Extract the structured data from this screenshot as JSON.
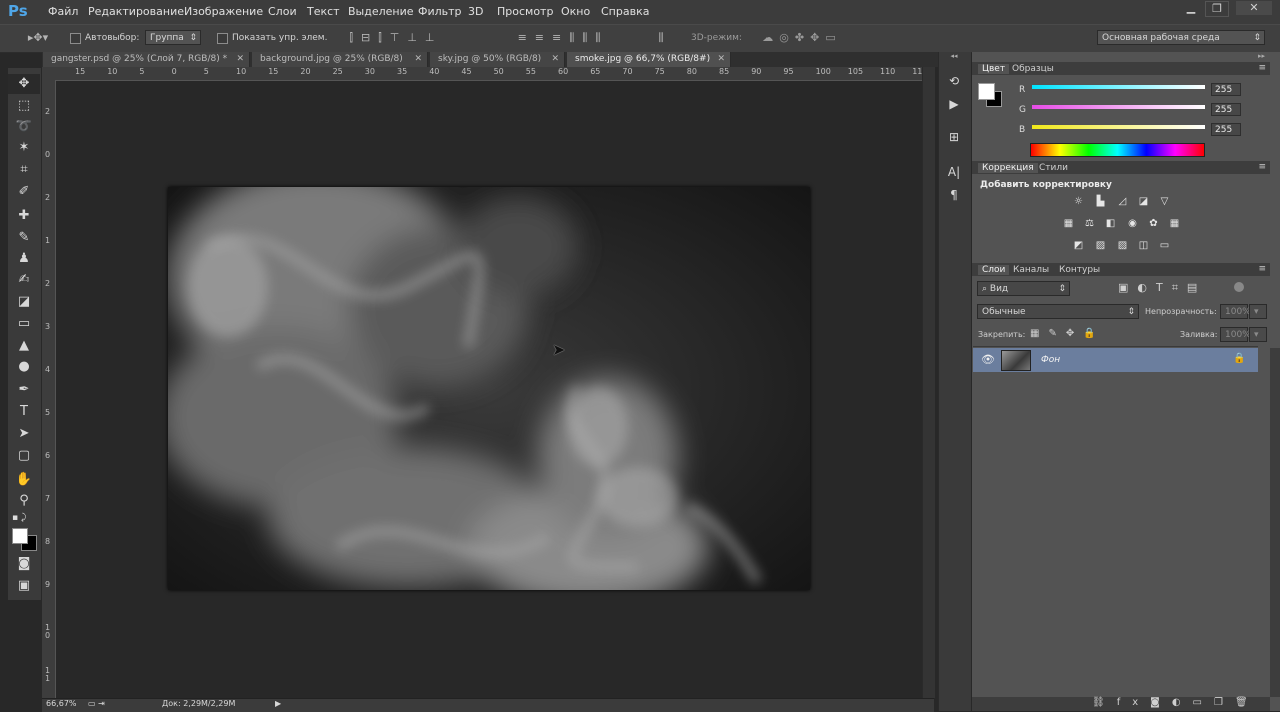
{
  "app": {
    "logo": "Ps"
  },
  "menu": [
    "Файл",
    "Редактирование",
    "Изображение",
    "Слои",
    "Текст",
    "Выделение",
    "Фильтр",
    "3D",
    "Просмотр",
    "Окно",
    "Справка"
  ],
  "window_buttons": {
    "minimize": "▁",
    "maximize": "❐",
    "close": "✕"
  },
  "options": {
    "autoselect_label": "Автовыбор:",
    "autoselect_value": "Группа",
    "show_transform_label": "Показать упр. элем.",
    "mode3d_label": "3D-режим:",
    "workspace": "Основная рабочая среда"
  },
  "tabs": [
    {
      "label": "gangster.psd @ 25% (Слой 7, RGB/8) *",
      "close": "✕"
    },
    {
      "label": "background.jpg @ 25% (RGB/8)",
      "close": "✕"
    },
    {
      "label": "sky.jpg @ 50% (RGB/8)",
      "close": "✕"
    },
    {
      "label": "smoke.jpg @ 66,7% (RGB/8#)",
      "close": "✕"
    }
  ],
  "ruler": {
    "h_ticks": [
      "15",
      "10",
      "5",
      "0",
      "5",
      "10",
      "15",
      "20",
      "25",
      "30",
      "35",
      "40",
      "45",
      "50",
      "55",
      "60",
      "65",
      "70",
      "75",
      "80",
      "85",
      "90",
      "95",
      "100",
      "105",
      "110",
      "115"
    ],
    "v_ticks": [
      "2",
      "0",
      "2",
      "1",
      "2",
      "3",
      "4",
      "5",
      "6",
      "7",
      "8",
      "9",
      "1 0",
      "1 1"
    ]
  },
  "status": {
    "zoom": "66,67%",
    "doc": "Док: 2,29M/2,29M",
    "arrow": "▶"
  },
  "color_panel": {
    "tabs": [
      "Цвет",
      "Образцы"
    ],
    "channels": [
      {
        "letter": "R",
        "value": "255",
        "gradient": "#00e5ff"
      },
      {
        "letter": "G",
        "value": "255",
        "gradient": "#e64ce6"
      },
      {
        "letter": "B",
        "value": "255",
        "gradient": "#f0e81a"
      }
    ]
  },
  "adjust_panel": {
    "tabs": [
      "Коррекция",
      "Стили"
    ],
    "title": "Добавить корректировку"
  },
  "layers_panel": {
    "tabs": [
      "Слои",
      "Каналы",
      "Контуры"
    ],
    "filter_label": "Вид",
    "blend_mode": "Обычные",
    "opacity_label": "Непрозрачность:",
    "opacity_value": "100%",
    "lock_label": "Закрепить:",
    "fill_label": "Заливка:",
    "fill_value": "100%",
    "layers": [
      {
        "name": "Фон",
        "visible": true,
        "locked": true
      }
    ]
  },
  "colors": {
    "accent": "#4fa6e8",
    "selected_layer": "#6b7e9e",
    "foreground": "#ffffff",
    "background": "#000000"
  }
}
